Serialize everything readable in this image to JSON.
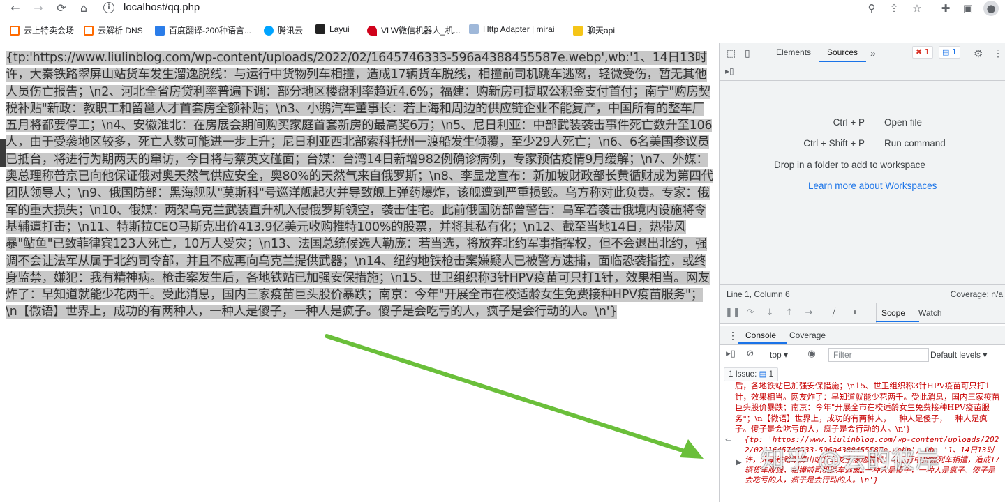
{
  "browser": {
    "url": "localhost/qq.php"
  },
  "bookmarks": [
    {
      "label": "云上特卖会场",
      "color": "#ff6a00"
    },
    {
      "label": "云解析 DNS",
      "color": "#ff6a00"
    },
    {
      "label": "百度翻译-200种语言...",
      "color": "#2b7de9"
    },
    {
      "label": "腾讯云",
      "color": "#00a4ff"
    },
    {
      "label": "Layui",
      "color": "#222222"
    },
    {
      "label": "VLW微信机器人_机...",
      "color": "#d0021b"
    },
    {
      "label": "Http Adapter | mirai",
      "color": "#9fb8d9"
    },
    {
      "label": "聊天api",
      "color": "#f5c518"
    }
  ],
  "page": {
    "json_text": "{tp:'https://www.liulinblog.com/wp-content/uploads/2022/02/1645746333-596a4388455587e.webp',wb:'1、14日13时许，大秦铁路翠屏山站货车发生溜逸脱线：与运行中货物列车相撞，造成17辆货车脱线，相撞前司机跳车逃离，轻微受伤，暂无其他人员伤亡报告；\\n2、河北全省房贷利率普遍下调：部分地区楼盘利率趋近4.6%；福建：购新房可提取公积金支付首付；南宁\"购房契税补贴\"新政：教职工和留邕人才首套房全额补贴；\\n3、小鹏汽车董事长：若上海和周边的供应链企业不能复产，中国所有的整车厂五月将都要停工；\\n4、安徽淮北：在房展会期间购买家庭首套新房的最高奖6万；\\n5、尼日利亚：中部武装袭击事件死亡数升至106人，由于受袭地区较多，死亡人数可能进一步上升；尼日利亚西北部索科托州一渡船发生倾覆，至少29人死亡；\\n6、6名美国参议员已抵台，将进行为期两天的窜访，今日将与蔡英文碰面；台媒：台湾14日新增982例确诊病例，专家预估疫情9月缓解；\\n7、外媒：奥总理称普京已向他保证俄对奥天然气供应安全，奥80%的天然气来自俄罗斯；\\n8、李显龙宣布：新加坡财政部长黄循财成为第四代团队领导人；\\n9、俄国防部：黑海舰队\"莫斯科\"号巡洋舰起火并导致舰上弹药爆炸，该舰遭到严重损毁。乌方称对此负责。专家：俄军的重大损失；\\n10、俄媒：两架乌克兰武装直升机入侵俄罗斯领空，袭击住宅。此前俄国防部曾警告：乌军若袭击俄境内设施将令基辅遭打击；\\n11、特斯拉CEO马斯克出价413.9亿美元收购推特100%的股票，并将其私有化；\\n12、截至当地14日，热带风暴\"鲇鱼\"已致菲律宾123人死亡，10万人受灾；\\n13、法国总统候选人勒庞：若当选，将放弃北约军事指挥权，但不会退出北约，强调不会让法军从属于北约司令部，并且不应再向乌克兰提供武器；\\n14、纽约地铁枪击案嫌疑人已被警方逮捕，面临恐袭指控，或终身监禁，嫌犯：我有精神病。枪击案发生后，各地铁站已加强安保措施；\\n15、世卫组织称3针HPV疫苗可只打1针，效果相当。网友炸了：早知道就能少花两千。受此消息，国内三家疫苗巨头股价暴跌；南京：今年\"开展全市在校适龄女生免费接种HPV疫苗服务\"；\\n【微语】世界上，成功的有两种人，一种人是傻子，一种人是疯子。傻子是会吃亏的人，疯子是会行动的人。\\n'}"
  },
  "devtools": {
    "tabs": [
      "Elements",
      "Sources"
    ],
    "errors": "1",
    "messages": "1",
    "shortcuts": [
      {
        "key": "Ctrl + P",
        "action": "Open file"
      },
      {
        "key": "Ctrl + Shift + P",
        "action": "Run command"
      }
    ],
    "drop_text": "Drop in a folder to add to workspace",
    "learn_link": "Learn more about Workspaces",
    "position": "Line 1, Column 6",
    "coverage": "Coverage: n/a",
    "scope_tab": "Scope",
    "watch_tab": "Watch",
    "console_tab": "Console",
    "coverage_tab": "Coverage",
    "context": "top",
    "filter_placeholder": "Filter",
    "levels": "Default levels",
    "issues_label": "1 Issue:",
    "issues_count": "1",
    "log_prev": "后，各地铁站已加强安保措施；\\n15、世卫组织称3针HPV疫苗可只打1针，效果相当。网友炸了：早知道就能少花两千。受此消息，国内三家疫苗巨头股价暴跌；南京：今年\"开展全市在校适龄女生免费接种HPV疫苗服务\"；\\n【微语】世界上，成功的有两种人，一种人是傻子，一种人是疯子。傻子是会吃亏的人，疯子是会行动的人。\\n'}",
    "log_obj": "{tp: 'https://www.liulinblog.com/wp-content/uploads/2022/02/1645746333-596a4388455587e.webp', wb: '1、14日13时许，大秦铁路翠屏山站货车发生溜逸脱线：与运行中货物列车相撞，造成17辆货车脱线，相撞前司机跳车逃离…一种人是傻子，一种人是疯子。傻子是会吃亏的人，疯子是会行动的人。\\n'}"
  },
  "overlay": {
    "watermark": "知乎 @云的彼岸",
    "arrow_color": "#6abf3a"
  }
}
